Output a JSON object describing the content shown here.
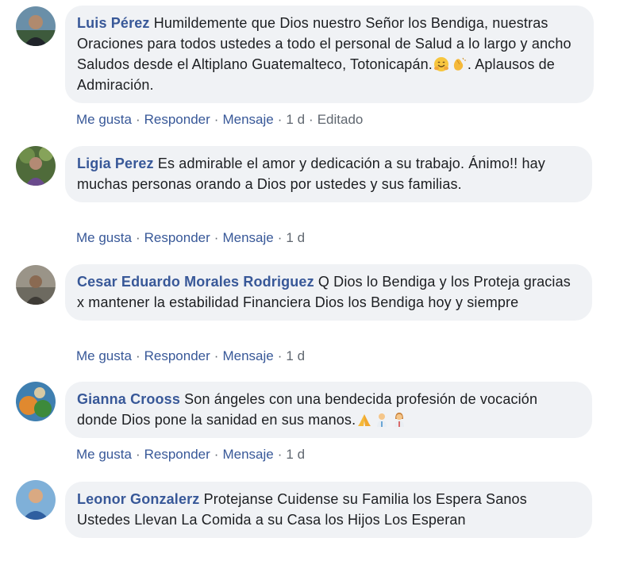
{
  "actions": {
    "like": "Me gusta",
    "reply": "Responder",
    "message": "Mensaje",
    "separator": "·"
  },
  "comments": [
    {
      "author": "Luis Pérez",
      "text_before": "Humildemente que Dios nuestro Señor los Bendiga, nuestras Oraciones para todos ustedes a todo el personal de Salud a lo largo y ancho Saludos desde el Altiplano Guatemalteco, Totonicapán.",
      "text_after": ". Aplausos de Admiración.",
      "emojis": [
        "hugging-face-icon",
        "clapping-hands-icon"
      ],
      "time": "1 d",
      "edited": "Editado"
    },
    {
      "author": "Ligia Perez",
      "text": "Es admirable el amor y dedicación a su trabajo. Ánimo!! hay muchas personas orando a Dios por ustedes y sus familias.",
      "time": "1 d"
    },
    {
      "author": "Cesar Eduardo Morales Rodriguez",
      "text": "Q Dios lo Bendiga y los Proteja gracias x mantener la estabilidad Financiera Dios los Bendiga hoy y siempre",
      "time": "1 d"
    },
    {
      "author": "Gianna Crooss",
      "text": "Son ángeles con una bendecida profesión de vocación donde Dios pone la sanidad en sus manos.",
      "emojis": [
        "praying-hands-icon",
        "health-worker-man-icon",
        "health-worker-woman-icon"
      ],
      "time": "1 d"
    },
    {
      "author": "Leonor Gonzalerz",
      "text": "Protejanse Cuidense su Familia los Espera Sanos Ustedes Llevan La Comida a su Casa los Hijos Los Esperan"
    }
  ],
  "colors": {
    "author": "#385898",
    "bubble": "#f0f2f5",
    "meta": "#606770"
  }
}
